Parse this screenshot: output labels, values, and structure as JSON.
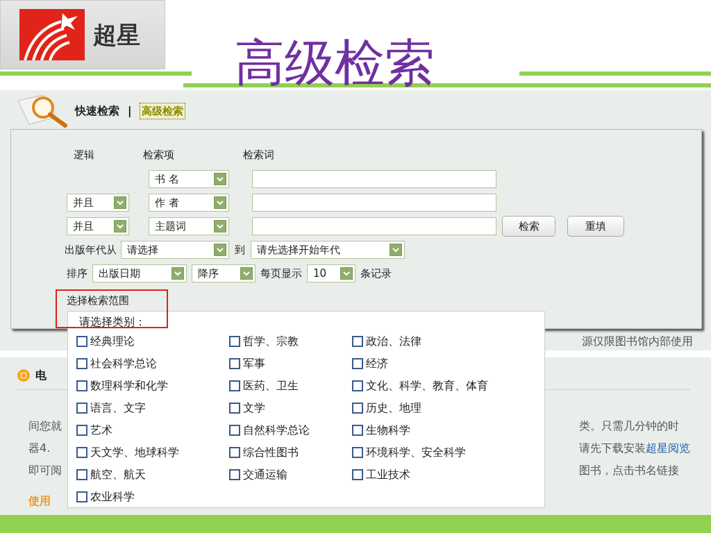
{
  "logo": {
    "text": "超星"
  },
  "slide_title": "高级检索",
  "tabs": [
    {
      "label": "快速检索",
      "selected": false
    },
    {
      "label": "高级检索",
      "selected": true
    }
  ],
  "tab_separator": "|",
  "form": {
    "headers": [
      "逻辑",
      "检索项",
      "检索词"
    ],
    "rows": [
      {
        "field": "书 名"
      },
      {
        "logic": "并且",
        "field": "作 者"
      },
      {
        "logic": "并且",
        "field": "主题词"
      }
    ],
    "buttons": [
      "检索",
      "重填"
    ],
    "year": {
      "label_from": "出版年代从",
      "from": "请选择",
      "label_to": "到",
      "to": "请先选择开始年代"
    },
    "sort": {
      "label": "排序",
      "field": "出版日期",
      "order": "降序",
      "per_page_label": "每页显示",
      "per_page": "10",
      "suffix": "条记录"
    },
    "scope_label": "选择检索范围"
  },
  "category_popup": {
    "title": "请选择类别：",
    "items": [
      {
        "label": "经典理论",
        "checked": false
      },
      {
        "label": "哲学、宗教",
        "checked": false
      },
      {
        "label": "政治、法律",
        "checked": false
      },
      {
        "label": "社会科学总论",
        "checked": false
      },
      {
        "label": "军事",
        "checked": false
      },
      {
        "label": "经济",
        "checked": false
      },
      {
        "label": "数理科学和化学",
        "checked": false
      },
      {
        "label": "医药、卫生",
        "checked": false
      },
      {
        "label": "文化、科学、教育、体育",
        "checked": false
      },
      {
        "label": "语言、文字",
        "checked": false
      },
      {
        "label": "文学",
        "checked": false
      },
      {
        "label": "历史、地理",
        "checked": false
      },
      {
        "label": "艺术",
        "checked": false
      },
      {
        "label": "自然科学总论",
        "checked": false
      },
      {
        "label": "生物科学",
        "checked": false
      },
      {
        "label": "天文学、地球科学",
        "checked": false
      },
      {
        "label": "综合性图书",
        "checked": false
      },
      {
        "label": "环境科学、安全科学",
        "checked": false
      },
      {
        "label": "航空、航天",
        "checked": false
      },
      {
        "label": "交通运输",
        "checked": false
      },
      {
        "label": "工业技术",
        "checked": false
      },
      {
        "label": "农业科学",
        "checked": false
      }
    ]
  },
  "background_panel": {
    "notice": "源仅限图书馆内部使用",
    "section_title": "电",
    "lines_left": [
      "间您就",
      "器4.",
      "即可阅"
    ],
    "lines_right": [
      {
        "text": "类。只需几分钟的时"
      },
      {
        "text": "请先下载安装",
        "link": "超星阅览"
      },
      {
        "text": "图书，点击书名链接"
      }
    ],
    "usage_label": "使用"
  }
}
